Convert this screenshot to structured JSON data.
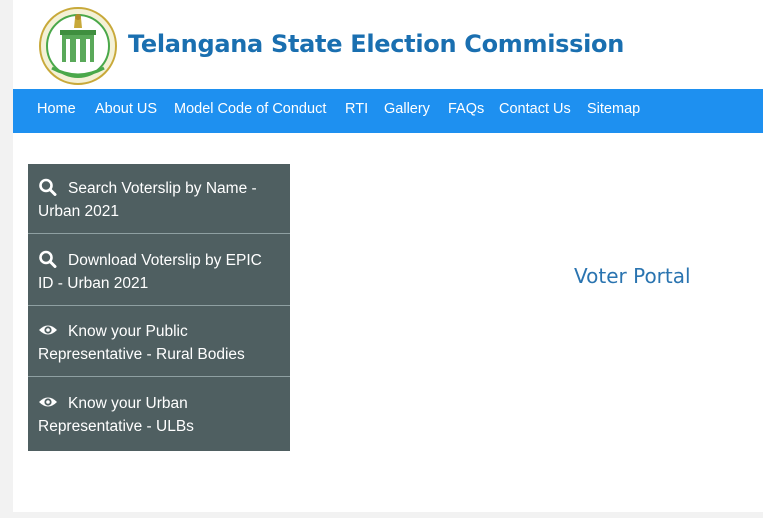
{
  "header": {
    "title": "Telangana State Election Commission",
    "logo_icon": "telangana-emblem-icon"
  },
  "nav": {
    "items": [
      {
        "label": "Home"
      },
      {
        "label": "About US"
      },
      {
        "label": "Model Code of Conduct"
      },
      {
        "label": "RTI"
      },
      {
        "label": "Gallery"
      },
      {
        "label": "FAQs"
      },
      {
        "label": "Contact Us"
      },
      {
        "label": "Sitemap"
      }
    ],
    "background": "#1e90f0"
  },
  "side_menu": {
    "background": "#4f5f61",
    "items": [
      {
        "icon": "search-icon",
        "line1": "Search Voterslip by Name -",
        "line2": "Urban 2021"
      },
      {
        "icon": "search-icon",
        "line1": "Download Voterslip by EPIC",
        "line2": "ID - Urban 2021"
      },
      {
        "icon": "eye-icon",
        "line1": "Know your Public",
        "line2": "Representative - Rural Bodies"
      },
      {
        "icon": "eye-icon",
        "line1": "Know your Urban",
        "line2": "Representative - ULBs"
      }
    ]
  },
  "main": {
    "heading": "Voter Portal"
  },
  "colors": {
    "title": "#1a6fb0",
    "portal_text": "#2a74b0"
  }
}
